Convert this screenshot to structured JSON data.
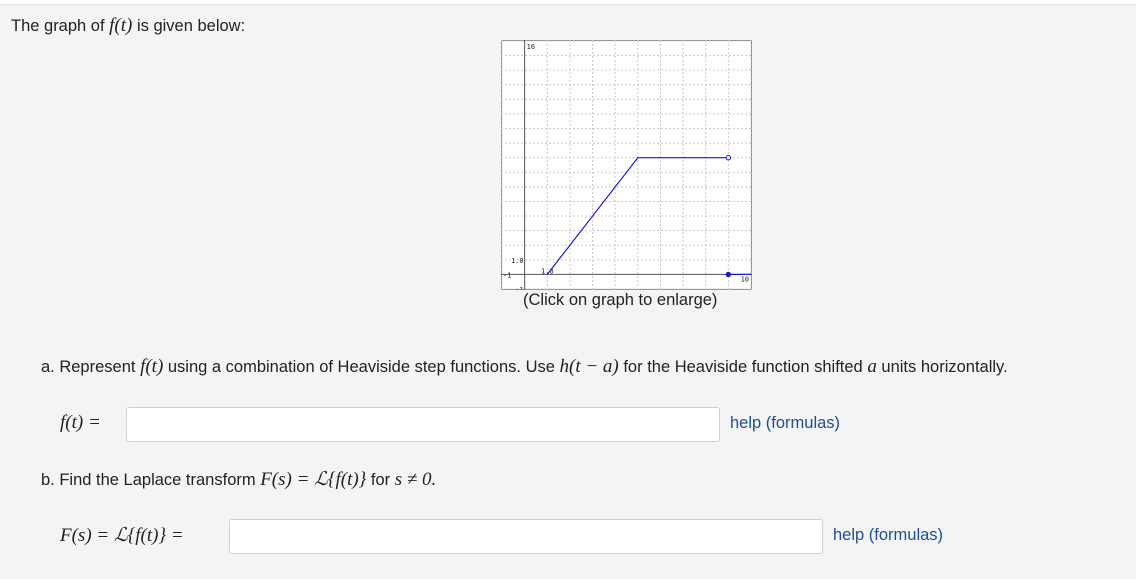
{
  "intro": {
    "pre": "The graph of ",
    "math": "f(t)",
    "post": " is given below:"
  },
  "graph": {
    "caption": "(Click on graph to enlarge)",
    "tick_labels": {
      "y_max": "16",
      "y_one": "1.0",
      "x_one": "1.0",
      "x_max": "10",
      "y_min": "-1",
      "x_min": "-1"
    },
    "colors": {
      "line": "#1a1adb",
      "grid": "#c8c8c8",
      "axis": "#555555"
    }
  },
  "chart_data": {
    "type": "line",
    "title": "",
    "xlabel": "",
    "ylabel": "",
    "xlim": [
      -1,
      10
    ],
    "ylim": [
      -1,
      16
    ],
    "grid": true,
    "series": [
      {
        "points": [
          [
            1,
            0
          ],
          [
            5,
            8
          ],
          [
            9,
            8
          ]
        ],
        "end_marker": "open"
      },
      {
        "points": [
          [
            9,
            0
          ],
          [
            10,
            0
          ]
        ],
        "start_marker": "closed"
      }
    ]
  },
  "part_a": {
    "prefix": "a. Represent ",
    "f_t": "f(t)",
    "text1": " using a combination of Heaviside step functions. Use ",
    "h": "h(t − a)",
    "text2": " for the Heaviside function shifted ",
    "a": "a",
    "text3": " units horizontally.",
    "label": "f(t) =",
    "help": "help (formulas)"
  },
  "part_b": {
    "prefix": "b. Find the Laplace transform ",
    "eq": "F(s) = ℒ{f(t)}",
    "text1": " for ",
    "cond": "s ≠ 0.",
    "label": "F(s) = ℒ{f(t)} =",
    "help": "help (formulas)"
  }
}
